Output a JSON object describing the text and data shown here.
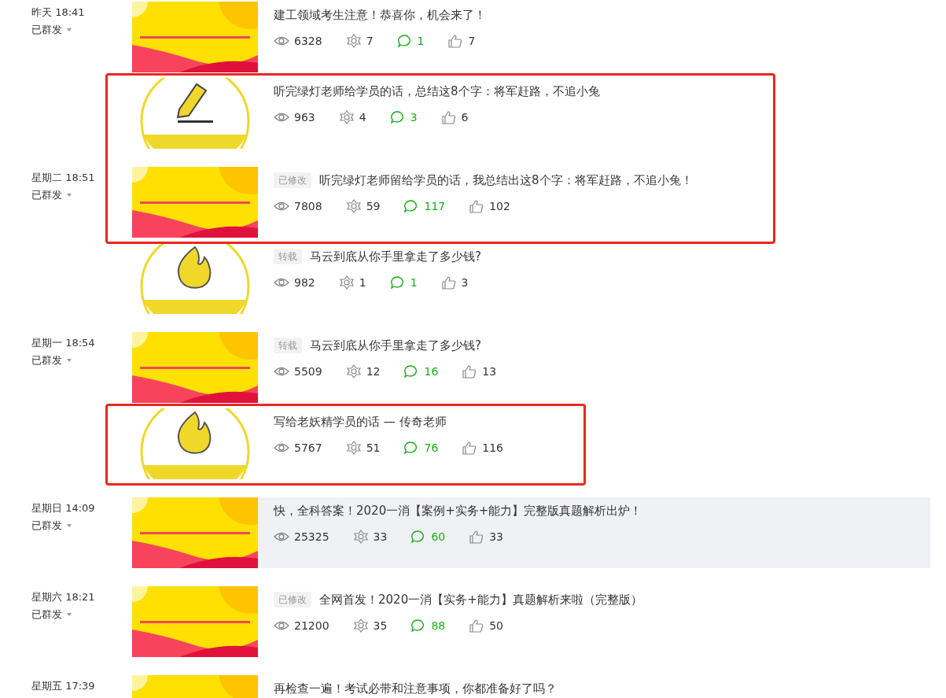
{
  "groups": [
    {
      "date": "昨天 18:41",
      "status": "已群发",
      "articles": [
        {
          "title": "建工领域考生注意！恭喜你，机会来了！",
          "views": "6328",
          "shares": "7",
          "comments": "1",
          "likes": "7",
          "marked": false,
          "hovered": false
        },
        {
          "title": "听完绿灯老师给学员的话，总结这8个字：将军赶路，不追小兔",
          "views": "963",
          "shares": "4",
          "comments": "3",
          "likes": "6",
          "marked": true,
          "hovered": false
        }
      ]
    },
    {
      "date": "星期二 18:51",
      "status": "已群发",
      "articles": [
        {
          "tag": "已修改",
          "title": "听完绿灯老师留给学员的话，我总结出这8个字：将军赶路，不追小兔！",
          "views": "7808",
          "shares": "59",
          "comments": "117",
          "likes": "102",
          "marked": true,
          "hovered": false
        },
        {
          "tag": "转载",
          "title": "马云到底从你手里拿走了多少钱?",
          "views": "982",
          "shares": "1",
          "comments": "1",
          "likes": "3",
          "marked": false,
          "hovered": false
        }
      ]
    },
    {
      "date": "星期一 18:54",
      "status": "已群发",
      "articles": [
        {
          "tag": "转载",
          "title": "马云到底从你手里拿走了多少钱?",
          "views": "5509",
          "shares": "12",
          "comments": "16",
          "likes": "13",
          "marked": false,
          "hovered": false
        },
        {
          "title": "写给老妖精学员的话 — 传奇老师",
          "views": "5767",
          "shares": "51",
          "comments": "76",
          "likes": "116",
          "marked": true,
          "hovered": false
        }
      ]
    },
    {
      "date": "星期日 14:09",
      "status": "已群发",
      "articles": [
        {
          "title": "快，全科答案！2020一消【案例+实务+能力】完整版真题解析出炉！",
          "views": "25325",
          "shares": "33",
          "comments": "60",
          "likes": "33",
          "marked": false,
          "hovered": true
        }
      ]
    },
    {
      "date": "星期六 18:21",
      "status": "已群发",
      "articles": [
        {
          "tag": "已修改",
          "title": "全网首发！2020一消【实务+能力】真题解析来啦（完整版）",
          "views": "21200",
          "shares": "35",
          "comments": "88",
          "likes": "50",
          "marked": false,
          "hovered": false
        }
      ]
    },
    {
      "date": "星期五 17:39",
      "articles": [
        {
          "title": "再检查一遍！考试必带和注意事项，你都准备好了吗？",
          "marked": false,
          "hovered": false
        }
      ]
    }
  ]
}
